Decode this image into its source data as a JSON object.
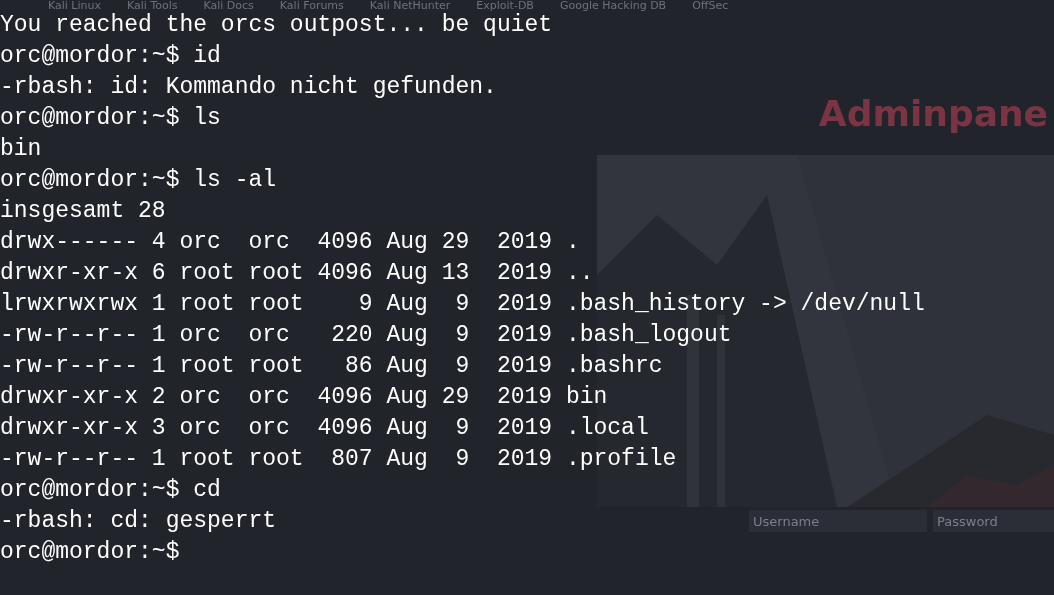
{
  "background_page": {
    "bookmarks": [
      "Kali Linux",
      "Kali Tools",
      "Kali Docs",
      "Kali Forums",
      "Kali NetHunter",
      "Exploit-DB",
      "Google Hacking DB",
      "OffSec"
    ],
    "heading": "Adminpane",
    "login": {
      "username_placeholder": "Username",
      "password_placeholder": "Password"
    }
  },
  "terminal": {
    "lines": [
      {
        "kind": "output",
        "text": "You reached the orcs outpost... be quiet"
      },
      {
        "kind": "prompt",
        "prompt": "orc@mordor:~$",
        "command": "id"
      },
      {
        "kind": "output",
        "text": "-rbash: id: Kommando nicht gefunden."
      },
      {
        "kind": "prompt",
        "prompt": "orc@mordor:~$",
        "command": "ls"
      },
      {
        "kind": "output",
        "text": "bin"
      },
      {
        "kind": "prompt",
        "prompt": "orc@mordor:~$",
        "command": "ls -al"
      },
      {
        "kind": "output",
        "text": "insgesamt 28"
      },
      {
        "kind": "output",
        "text": "drwx------ 4 orc  orc  4096 Aug 29  2019 ."
      },
      {
        "kind": "output",
        "text": "drwxr-xr-x 6 root root 4096 Aug 13  2019 .."
      },
      {
        "kind": "output",
        "text": "lrwxrwxrwx 1 root root    9 Aug  9  2019 .bash_history -> /dev/null"
      },
      {
        "kind": "output",
        "text": "-rw-r--r-- 1 orc  orc   220 Aug  9  2019 .bash_logout"
      },
      {
        "kind": "output",
        "text": "-rw-r--r-- 1 root root   86 Aug  9  2019 .bashrc"
      },
      {
        "kind": "output",
        "text": "drwxr-xr-x 2 orc  orc  4096 Aug 29  2019 bin"
      },
      {
        "kind": "output",
        "text": "drwxr-xr-x 3 orc  orc  4096 Aug  9  2019 .local"
      },
      {
        "kind": "output",
        "text": "-rw-r--r-- 1 root root  807 Aug  9  2019 .profile"
      },
      {
        "kind": "prompt",
        "prompt": "orc@mordor:~$",
        "command": "cd"
      },
      {
        "kind": "output",
        "text": "-rbash: cd: gesperrt"
      },
      {
        "kind": "prompt",
        "prompt": "orc@mordor:~$"
      }
    ]
  }
}
